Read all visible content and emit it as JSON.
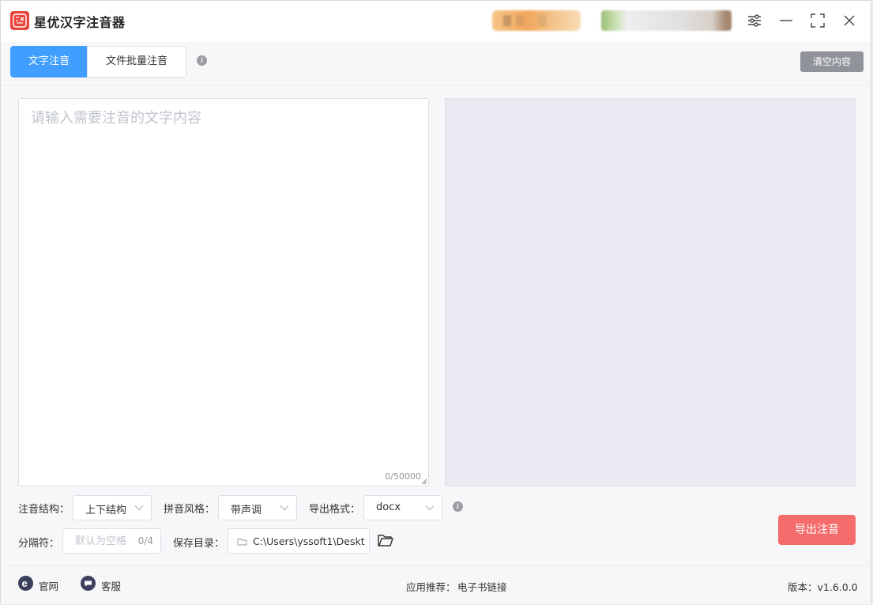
{
  "app": {
    "title": "星优汉字注音器",
    "logo_icon": "app-logo-icon",
    "brand_color": "#e8453c"
  },
  "tabs": [
    {
      "label": "文字注音",
      "active": true
    },
    {
      "label": "文件批量注音",
      "active": false
    }
  ],
  "toolbar": {
    "clear_label": "清空内容"
  },
  "editor": {
    "placeholder": "请输入需要注音的文字内容",
    "counter": "0/50000"
  },
  "options": {
    "structure_label": "注音结构：",
    "structure_value": "上下结构",
    "style_label": "拼音风格：",
    "style_value": "带声调",
    "format_label": "导出格式：",
    "format_value": "docx",
    "separator_label": "分隔符：",
    "separator_placeholder": "默认为空格",
    "separator_count": "0/4",
    "savedir_label": "保存目录：",
    "savedir_value": "C:\\Users\\yssoft1\\Deskt"
  },
  "export": {
    "label": "导出注音",
    "color": "#f56c6c"
  },
  "footer": {
    "website": "官网",
    "support": "客服",
    "rec_label": "应用推荐：",
    "rec_link": "电子书链接",
    "version": "版本：v1.6.0.0"
  },
  "colors": {
    "primary": "#409eff",
    "gray_button": "#909399",
    "preview_bg": "#eaeaf2"
  }
}
